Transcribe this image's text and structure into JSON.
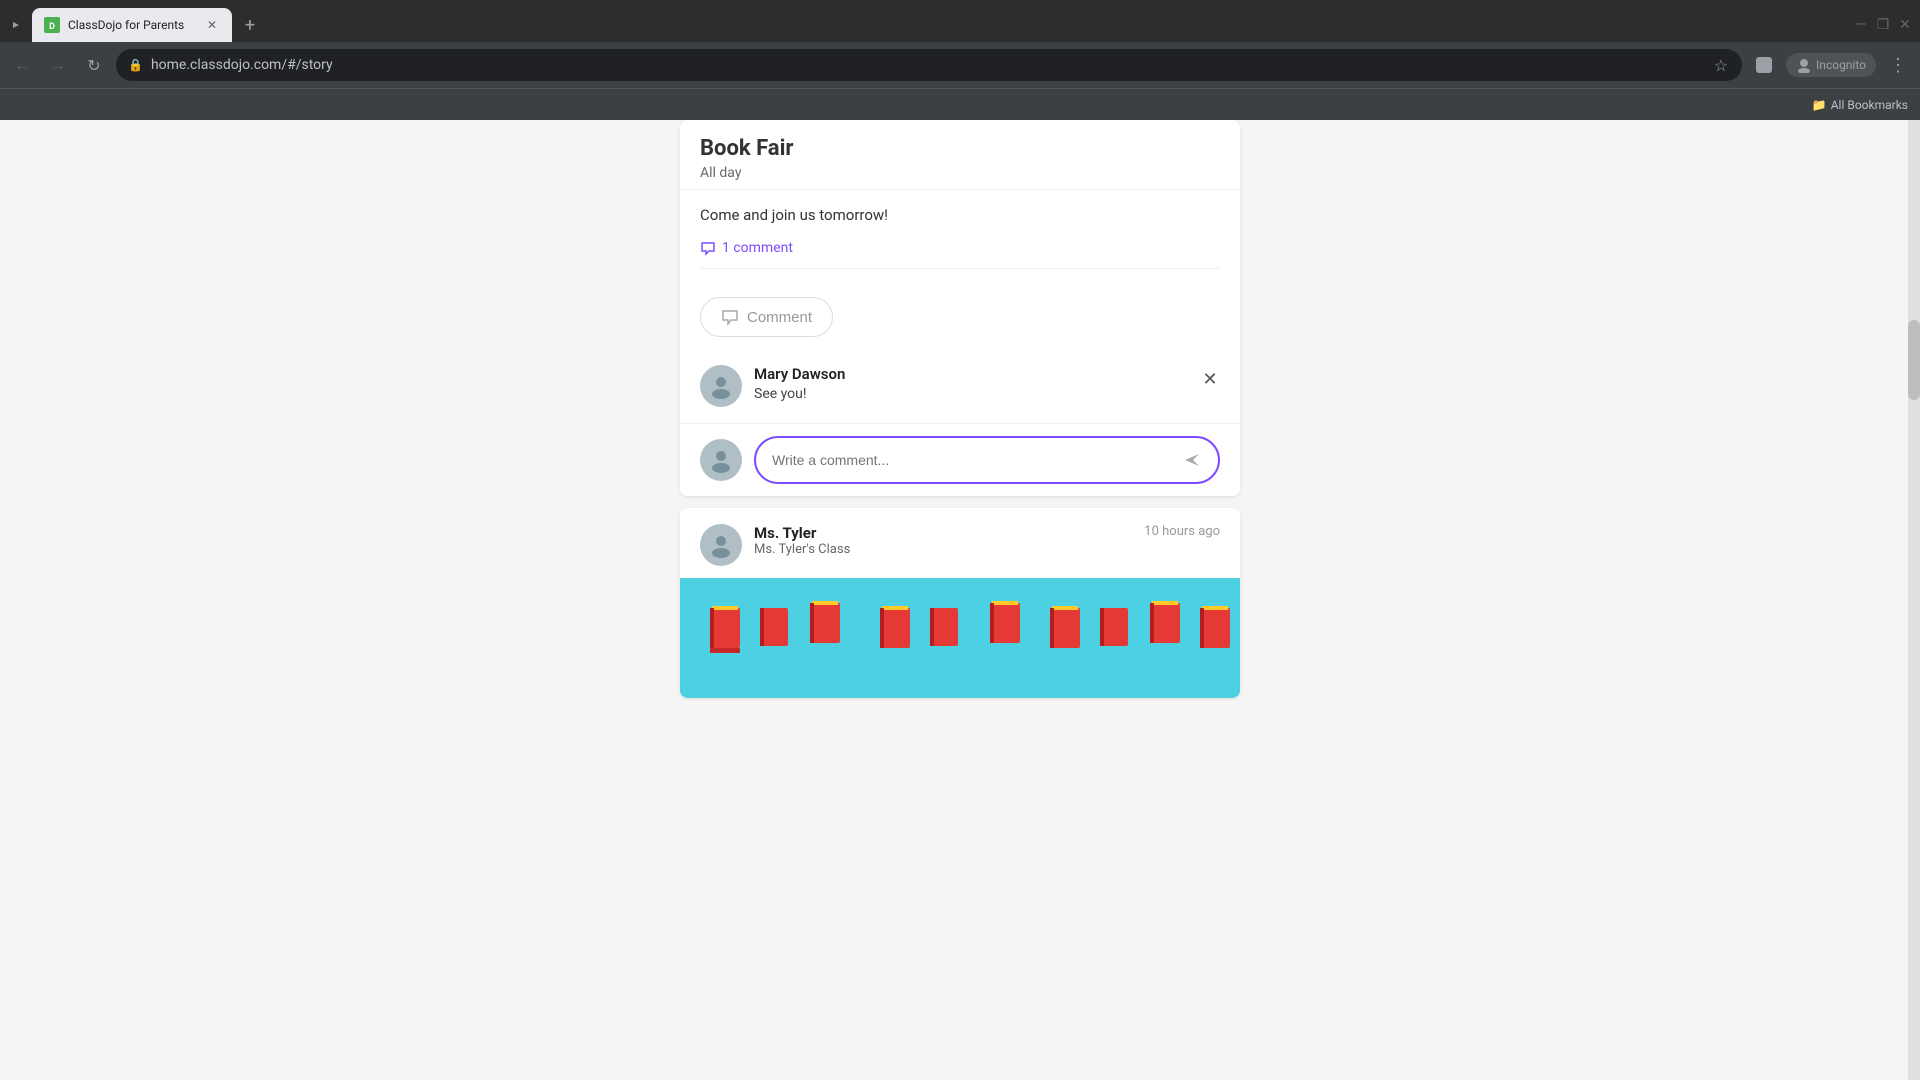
{
  "browser": {
    "tab": {
      "title": "ClassDojo for Parents",
      "favicon": "D",
      "url": "home.classdojo.com/#/story"
    },
    "new_tab_label": "+",
    "incognito_label": "Incognito",
    "bookmarks_label": "All Bookmarks"
  },
  "window_controls": {
    "minimize": "—",
    "maximize": "❐",
    "close": "✕"
  },
  "page": {
    "event": {
      "title": "Book Fair",
      "time": "All day",
      "description": "Come and join us tomorrow!",
      "comment_count": "1 comment",
      "comment_btn_label": "Comment"
    },
    "comment": {
      "author": "Mary Dawson",
      "text": "See you!",
      "close_icon": "✕",
      "input_placeholder": "Write a comment...",
      "send_icon": "➤"
    },
    "ms_tyler_post": {
      "name": "Ms. Tyler",
      "class": "Ms. Tyler's Class",
      "time": "10 hours ago"
    }
  },
  "colors": {
    "accent": "#7c4dff",
    "avatar_bg": "#b0bec5",
    "book_image_bg": "#4dd0e1"
  }
}
